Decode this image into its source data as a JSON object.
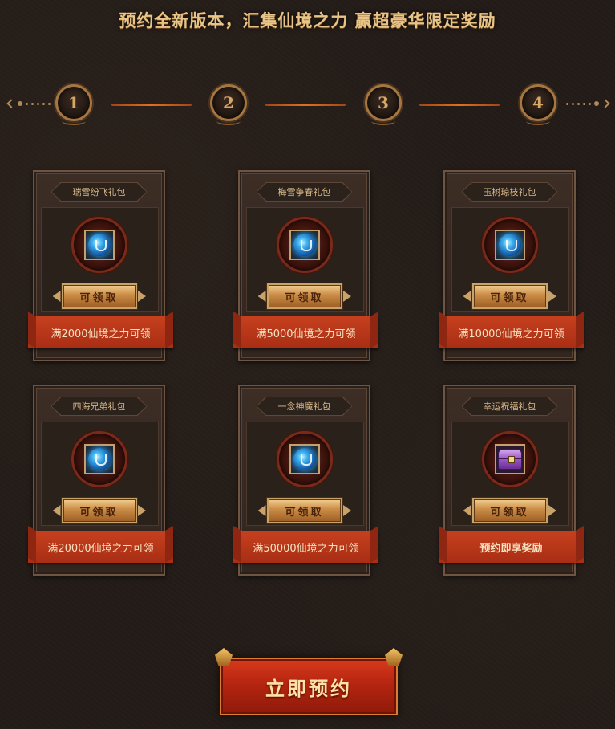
{
  "headline": "预约全新版本，汇集仙境之力 赢超豪华限定奖励",
  "steps": [
    "1",
    "2",
    "3",
    "4"
  ],
  "cards": [
    {
      "name": "瑞雪纷飞礼包",
      "button": "可领取",
      "condition": "满2000仙境之力可领",
      "icon": "blue-orb-icon"
    },
    {
      "name": "梅雪争春礼包",
      "button": "可领取",
      "condition": "满5000仙境之力可领",
      "icon": "blue-orb-icon"
    },
    {
      "name": "玉树琼枝礼包",
      "button": "可领取",
      "condition": "满10000仙境之力可领",
      "icon": "blue-orb-icon"
    },
    {
      "name": "四海兄弟礼包",
      "button": "可领取",
      "condition": "满20000仙境之力可领",
      "icon": "blue-orb-icon"
    },
    {
      "name": "一念神魔礼包",
      "button": "可领取",
      "condition": "满50000仙境之力可领",
      "icon": "blue-orb-icon"
    },
    {
      "name": "幸运祝福礼包",
      "button": "可领取",
      "condition": "预约即享奖励",
      "icon": "purple-chest-icon"
    }
  ],
  "cta": {
    "label": "立即预约"
  },
  "colors": {
    "accent": "#c6401e",
    "gold": "#e8c486",
    "background": "#221b17"
  }
}
